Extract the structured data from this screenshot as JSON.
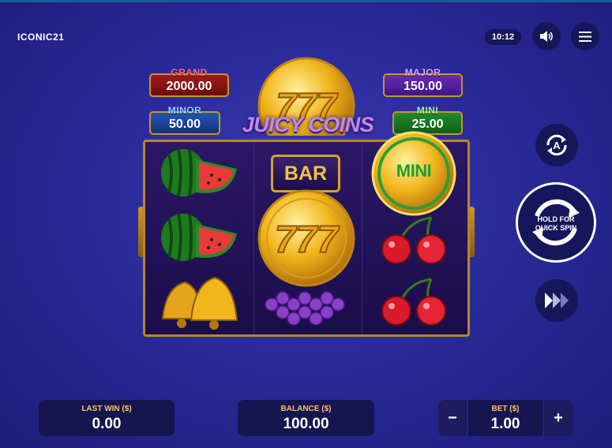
{
  "brand": {
    "logo_text": "ICONIC21"
  },
  "header": {
    "clock": "10:12",
    "icons": [
      "sound-icon",
      "menu-icon"
    ]
  },
  "game": {
    "title": "JUICY COINS",
    "jackpots": {
      "grand": {
        "label": "GRAND",
        "value": "2000.00"
      },
      "major": {
        "label": "MAJOR",
        "value": "150.00"
      },
      "minor": {
        "label": "MINOR",
        "value": "50.00"
      },
      "mini": {
        "label": "MINI",
        "value": "25.00"
      }
    },
    "reels": [
      [
        "watermelon",
        "watermelon",
        "bells"
      ],
      [
        "bar",
        "seven-coin",
        "grapes"
      ],
      [
        "mini-coin",
        "cherries",
        "cherries"
      ]
    ],
    "symbol_text": {
      "bar": "BAR",
      "mini_coin": "MINI"
    }
  },
  "controls": {
    "autoplay_icon": "autoplay-icon",
    "quick_spin_label_1": "HOLD FOR",
    "quick_spin_label_2": "QUICK SPIN",
    "turbo_icon": "turbo-icon"
  },
  "footer": {
    "last_win": {
      "label": "LAST WIN ($)",
      "value": "0.00"
    },
    "balance": {
      "label": "BALANCE ($)",
      "value": "100.00"
    },
    "bet": {
      "label": "BET ($)",
      "value": "1.00",
      "minus": "−",
      "plus": "+"
    }
  }
}
